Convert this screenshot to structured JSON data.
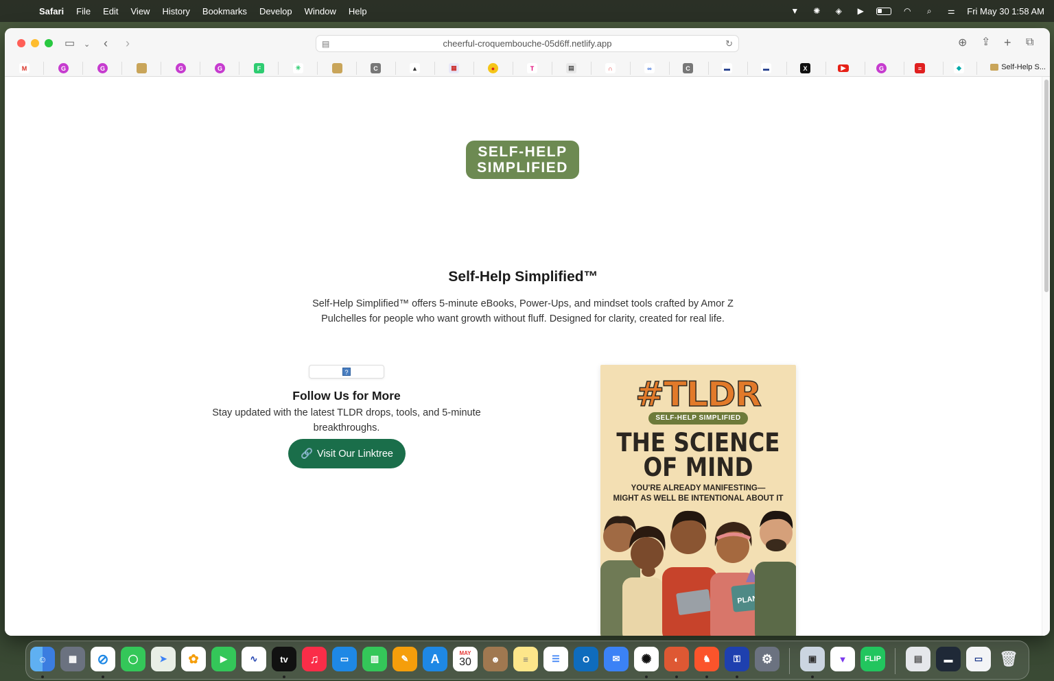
{
  "menubar": {
    "app_name": "Safari",
    "items": [
      "File",
      "Edit",
      "View",
      "History",
      "Bookmarks",
      "Develop",
      "Window",
      "Help"
    ],
    "datetime": "Fri May 30  1:58 AM"
  },
  "browser": {
    "url": "cheerful-croquembouche-05d6ff.netlify.app",
    "active_tab_label": "Self-Help S..."
  },
  "page": {
    "logo_line1": "SELF-HELP",
    "logo_line2": "SIMPLIFIED",
    "title": "Self-Help Simplified™",
    "description": "Self-Help Simplified™ offers 5-minute eBooks, Power-Ups, and mindset tools crafted by Amor Z Pulchelles for people who want growth without fluff. Designed for clarity, created for real life.",
    "broken_image_glyph": "?",
    "follow_title": "Follow Us for More",
    "follow_text": "Stay updated with the latest TLDR drops, tools, and 5-minute breakthroughs.",
    "linktree_icon": "🔗",
    "linktree_label": "Visit Our Linktree"
  },
  "book": {
    "brand": "#TLDR",
    "tag": "SELF-HELP SIMPLIFIED",
    "title_line1": "THE SCIENCE",
    "title_line2": "OF MIND",
    "subtitle_line1": "YOU'RE ALREADY MANIFESTING—",
    "subtitle_line2": "MIGHT AS WELL BE INTENTIONAL ABOUT IT",
    "planner_label": "PLANNER"
  },
  "dock": {
    "calendar_month": "MAY",
    "calendar_day": "30",
    "appletv_label": "tv",
    "flip_label": "FLIP"
  },
  "colors": {
    "logo_green": "#6d8a52",
    "button_green": "#1a6e4a",
    "book_bg": "#f3dfb3",
    "brand_orange": "#e27a2a"
  }
}
